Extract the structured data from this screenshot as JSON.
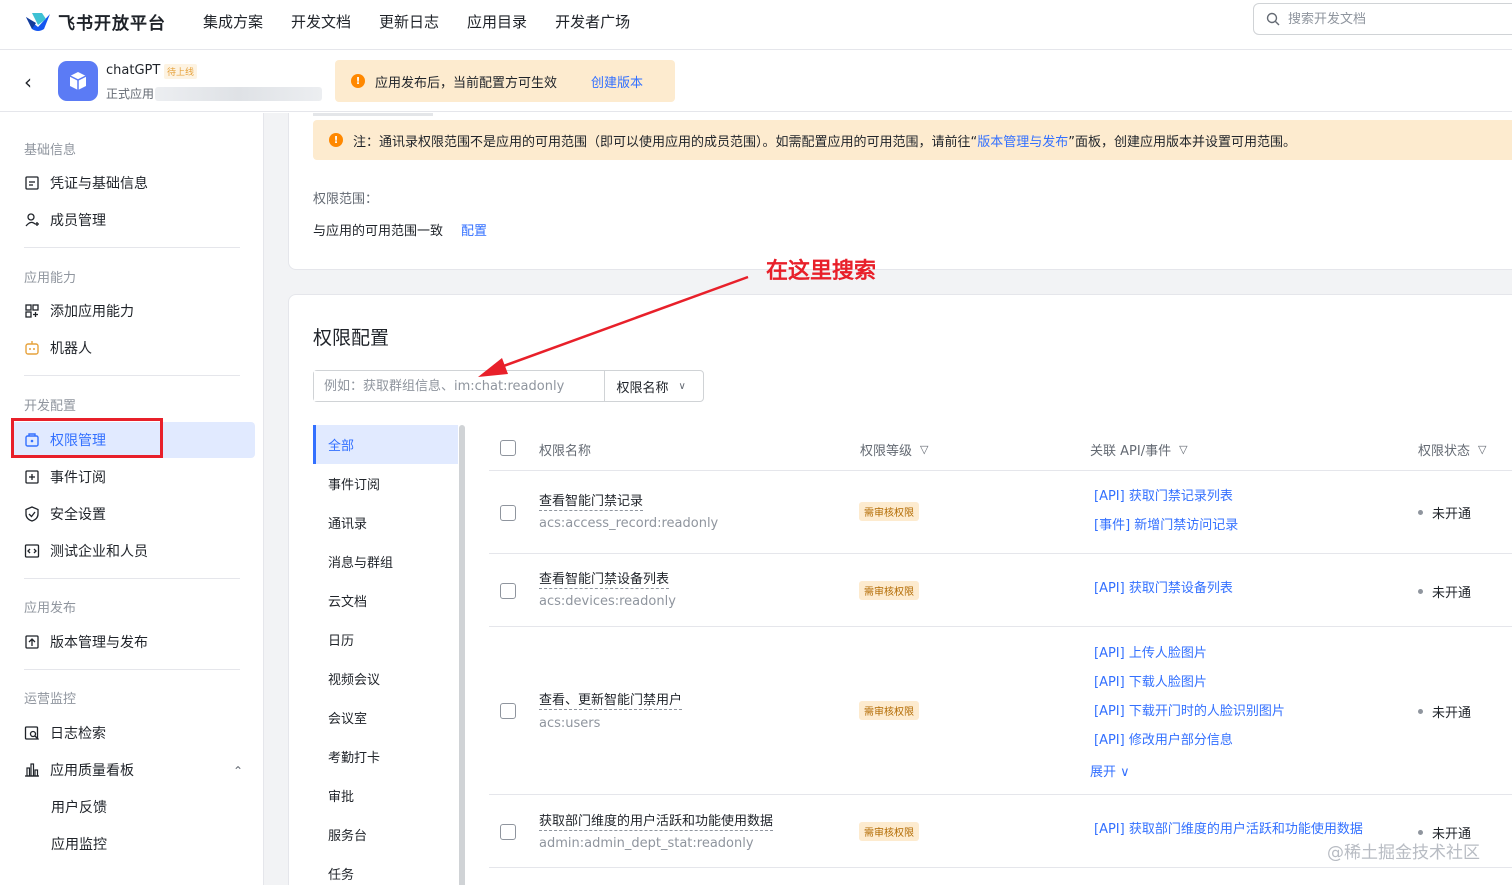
{
  "topnav": {
    "logo_text": "飞书开放平台",
    "links": [
      "集成方案",
      "开发文档",
      "更新日志",
      "应用目录",
      "开发者广场"
    ],
    "search_placeholder": "搜索开发文档"
  },
  "app": {
    "name": "chatGPT",
    "badge": "待上线",
    "type": "正式应用",
    "notice_text": "应用发布后，当前配置方可生效",
    "notice_link": "创建版本"
  },
  "sidebar": {
    "sections": [
      {
        "title": "基础信息",
        "items": [
          {
            "label": "凭证与基础信息",
            "icon": "document-icon"
          },
          {
            "label": "成员管理",
            "icon": "user-add-icon"
          }
        ]
      },
      {
        "title": "应用能力",
        "items": [
          {
            "label": "添加应用能力",
            "icon": "grid-icon"
          },
          {
            "label": "机器人",
            "icon": "robot-icon"
          }
        ]
      },
      {
        "title": "开发配置",
        "items": [
          {
            "label": "权限管理",
            "icon": "lock-icon"
          },
          {
            "label": "事件订阅",
            "icon": "event-icon"
          },
          {
            "label": "安全设置",
            "icon": "shield-icon"
          },
          {
            "label": "测试企业和人员",
            "icon": "code-icon"
          }
        ]
      },
      {
        "title": "应用发布",
        "items": [
          {
            "label": "版本管理与发布",
            "icon": "upload-icon"
          }
        ]
      },
      {
        "title": "运营监控",
        "items": [
          {
            "label": "日志检索",
            "icon": "search-log-icon"
          },
          {
            "label": "应用质量看板",
            "icon": "chart-icon"
          },
          {
            "label": "用户反馈",
            "icon": ""
          },
          {
            "label": "应用监控",
            "icon": ""
          }
        ]
      }
    ],
    "active": "权限管理"
  },
  "scope_card": {
    "note_prefix": "注：通讯录权限范围不是应用的可用范围（即可以使用应用的成员范围）。如需配置应用的可用范围，请前往“",
    "note_link": "版本管理与发布",
    "note_suffix": "”面板，创建应用版本并设置可用范围。",
    "scope_label": "权限范围：",
    "scope_text": "与应用的可用范围一致",
    "scope_link": "配置"
  },
  "annotation": "在这里搜索",
  "perm_config": {
    "title": "权限配置",
    "search_placeholder": "例如：获取群组信息、im:chat:readonly",
    "select_value": "权限名称",
    "categories": [
      "全部",
      "事件订阅",
      "通讯录",
      "消息与群组",
      "云文档",
      "日历",
      "视频会议",
      "会议室",
      "考勤打卡",
      "审批",
      "服务台",
      "任务"
    ],
    "columns": {
      "name": "权限名称",
      "level": "权限等级",
      "api": "关联 API/事件",
      "status": "权限状态"
    },
    "rows": [
      {
        "name": "查看智能门禁记录",
        "key": "acs:access_record:readonly",
        "level": "需审核权限",
        "apis": [
          "[API] 获取门禁记录列表",
          "[事件] 新增门禁访问记录"
        ],
        "status": "未开通"
      },
      {
        "name": "查看智能门禁设备列表",
        "key": "acs:devices:readonly",
        "level": "需审核权限",
        "apis": [
          "[API] 获取门禁设备列表"
        ],
        "status": "未开通"
      },
      {
        "name": "查看、更新智能门禁用户",
        "key": "acs:users",
        "level": "需审核权限",
        "apis": [
          "[API] 上传人脸图片",
          "[API] 下载人脸图片",
          "[API] 下载开门时的人脸识别图片",
          "[API] 修改用户部分信息"
        ],
        "expand": "展开",
        "status": "未开通"
      },
      {
        "name": "获取部门维度的用户活跃和功能使用数据",
        "key": "admin:admin_dept_stat:readonly",
        "level": "需审核权限",
        "apis": [
          "[API] 获取部门维度的用户活跃和功能使用数据"
        ],
        "status": "未开通"
      }
    ]
  },
  "watermark": "@稀土掘金技术社区",
  "colors": {
    "accent": "#3370ff",
    "warning_bg": "#fdebcf",
    "annotation": "#e8202a"
  }
}
